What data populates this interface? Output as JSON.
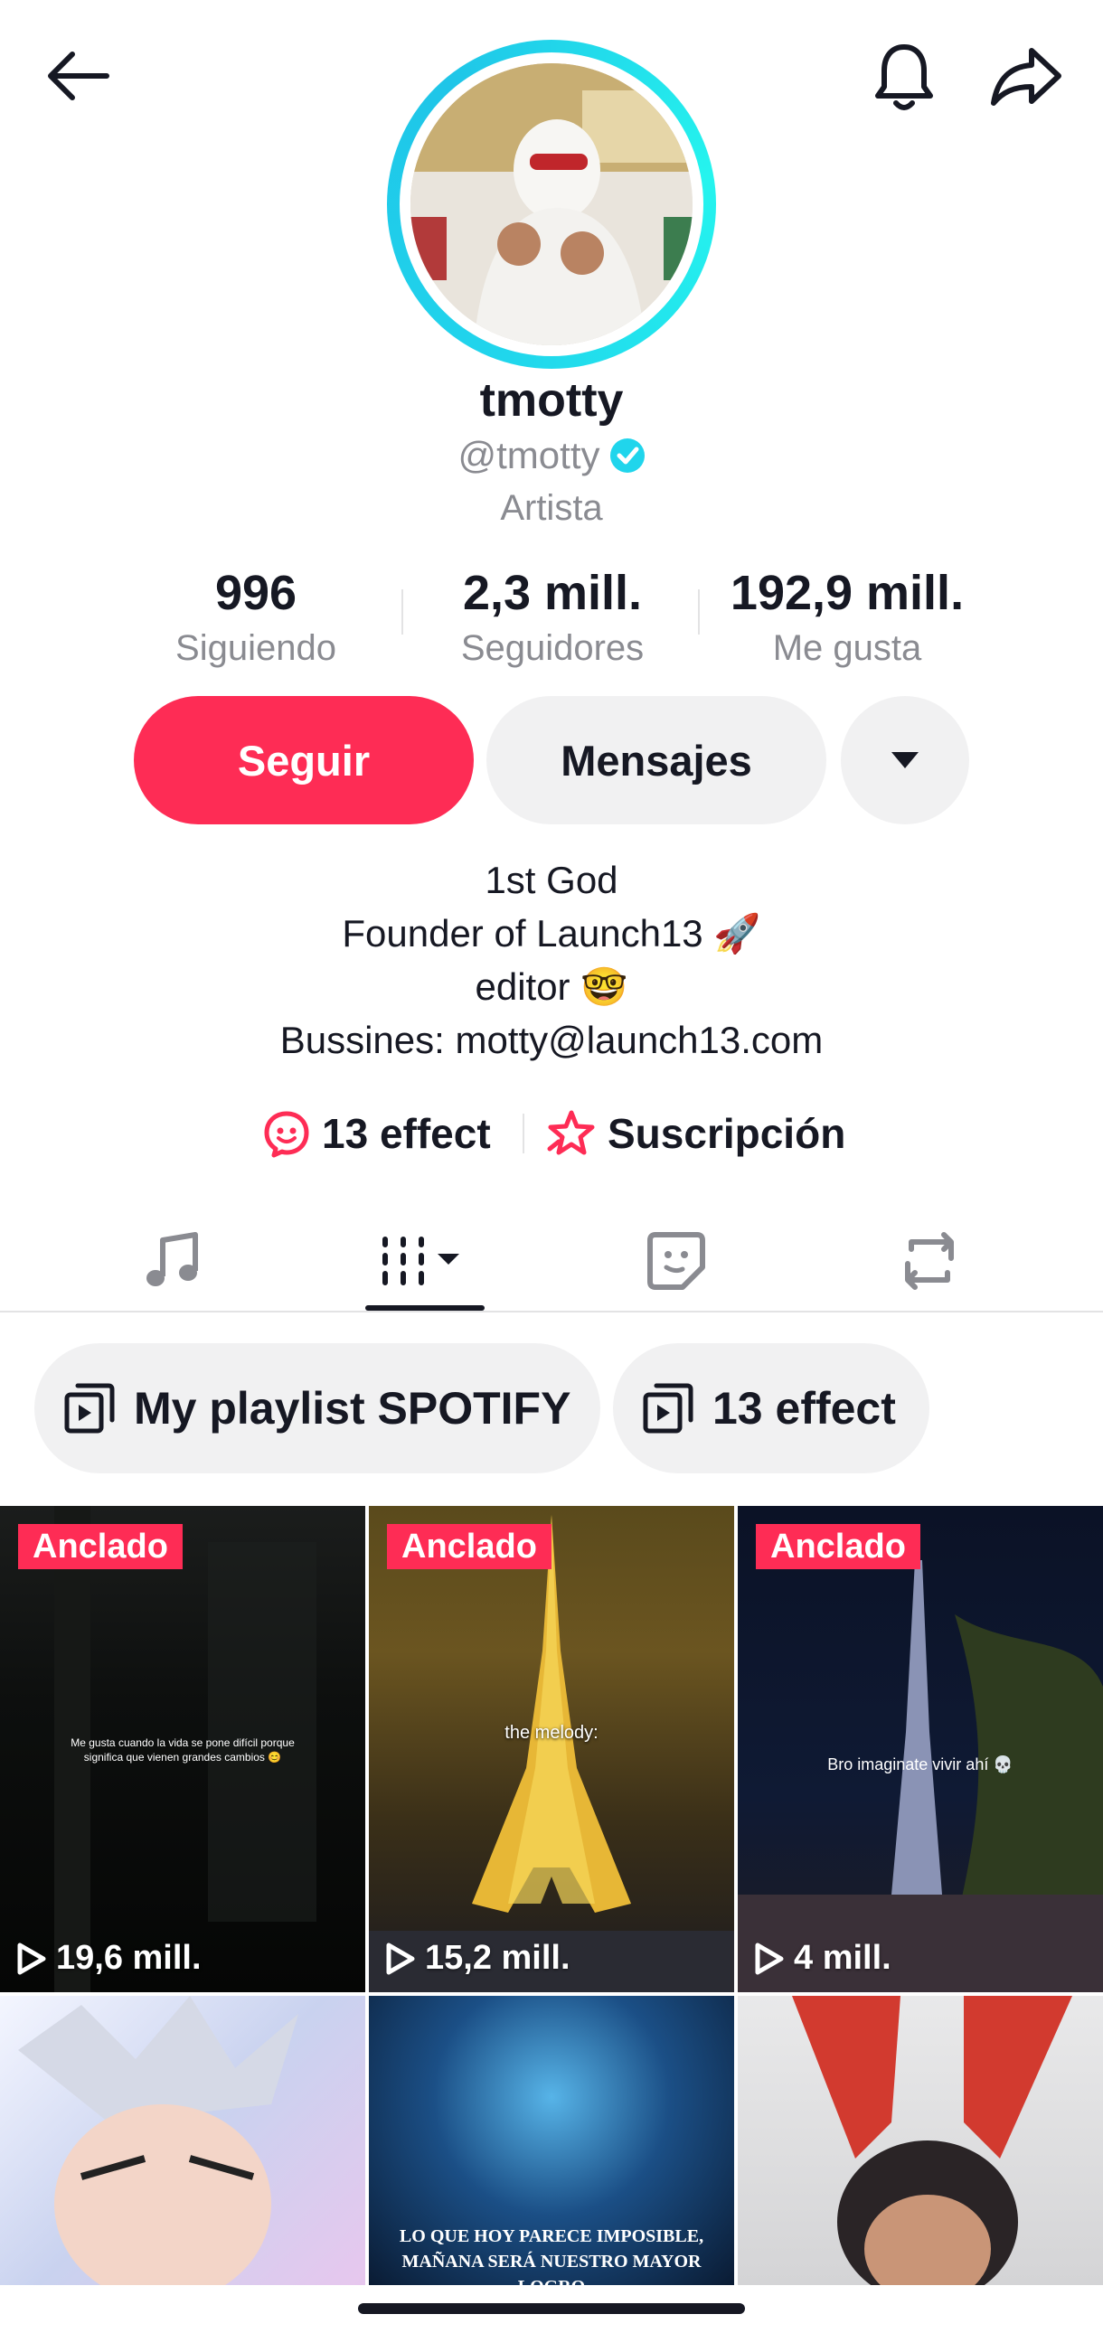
{
  "header": {
    "back_icon": "arrow-left-icon",
    "bell_icon": "bell-icon",
    "share_icon": "share-arrow-icon"
  },
  "profile": {
    "display_name": "tmotty",
    "username": "@tmotty",
    "verified": true,
    "category": "Artista",
    "ring_color": "#20d5ec"
  },
  "stats": [
    {
      "value": "996",
      "label": "Siguiendo"
    },
    {
      "value": "2,3 mill.",
      "label": "Seguidores"
    },
    {
      "value": "192,9 mill.",
      "label": "Me gusta"
    }
  ],
  "actions": {
    "follow_label": "Seguir",
    "follow_color": "#fe2c55",
    "message_label": "Mensajes",
    "more_icon": "caret-down-icon"
  },
  "bio": [
    "1st God",
    "Founder of Launch13 🚀",
    "editor 🤓",
    "Bussines: motty@launch13.com"
  ],
  "links": {
    "effect_label": "13 effect",
    "subscription_label": "Suscripción"
  },
  "tabs": [
    {
      "icon": "music-note-icon"
    },
    {
      "icon": "videos-grid-icon",
      "active": true
    },
    {
      "icon": "sticker-icon"
    },
    {
      "icon": "repost-icon"
    }
  ],
  "playlists": [
    {
      "label": "My playlist SPOTIFY"
    },
    {
      "label": "13 effect"
    }
  ],
  "videos": [
    {
      "pinned_label": "Anclado",
      "views": "19,6 mill.",
      "caption": "Me gusta cuando la vida se pone difícil porque significa que vienen grandes cambios 😊"
    },
    {
      "pinned_label": "Anclado",
      "views": "15,2 mill.",
      "caption": "the melody:"
    },
    {
      "pinned_label": "Anclado",
      "views": "4 mill.",
      "caption": "Bro imaginate vivir ahí 💀"
    },
    {
      "caption": ""
    },
    {
      "caption": "LO QUE HOY PARECE IMPOSIBLE, MAÑANA SERÁ NUESTRO MAYOR LOGRO"
    },
    {
      "caption": ""
    }
  ]
}
